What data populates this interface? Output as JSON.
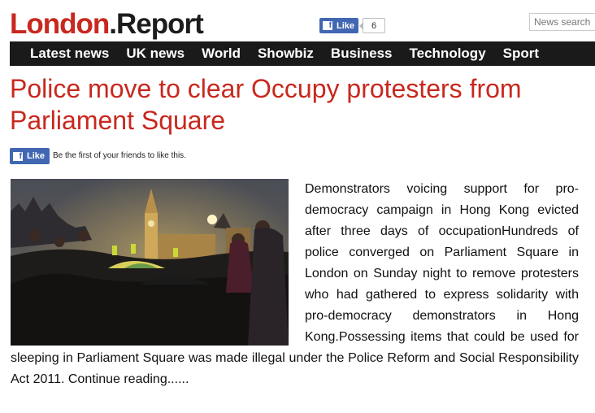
{
  "site": {
    "logo_part1": "London",
    "logo_part2": ".Report"
  },
  "header": {
    "like_label": "Like",
    "like_count": "6",
    "search_placeholder": "News search"
  },
  "nav": {
    "items": [
      "Latest news",
      "UK news",
      "World",
      "Showbiz",
      "Business",
      "Technology",
      "Sport"
    ]
  },
  "article": {
    "title": "Police move to clear Occupy protesters from Parliament Square",
    "like_label": "Like",
    "social_text": "Be the first of your friends to like this.",
    "body": "Demonstrators voicing support for pro-democracy campaign in Hong Kong evicted after three days of occupationHundreds of police converged on Parliament Square in London on Sunday night to remove protesters who had gathered to express solidarity with pro-democracy demonstrators in Hong Kong.Possessing items that could be used for sleeping in Parliament Square was made illegal under the Police Reform and Social Responsibility Act 2011. Continue reading......"
  },
  "colors": {
    "brand_red": "#c8281e",
    "nav_bg": "#1a1a1a",
    "facebook_blue": "#4267b2"
  },
  "icons": {
    "facebook": "facebook-f-icon"
  }
}
